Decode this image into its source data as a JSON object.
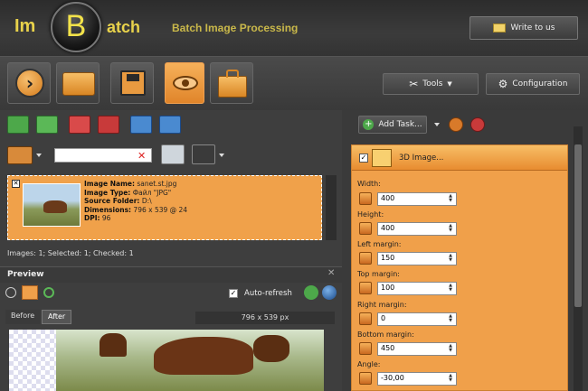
{
  "header": {
    "logo_left": "Im",
    "logo_mid": "B",
    "logo_right": "atch",
    "subtitle": "Batch Image Processing",
    "write_button": "Write to us"
  },
  "toolbar": {
    "tools_label": "Tools",
    "config_label": "Configuration"
  },
  "images": {
    "search_value": "",
    "details": [
      {
        "label": "Image Name:",
        "value": "sanet.st.jpg"
      },
      {
        "label": "Image Type:",
        "value": "Файл \"JPG\""
      },
      {
        "label": "Source Folder:",
        "value": "D:\\"
      },
      {
        "label": "Dimensions:",
        "value": "796 x 539 @ 24"
      },
      {
        "label": "DPI:",
        "value": "96"
      }
    ],
    "status": "Images: 1; Selected: 1; Checked: 1"
  },
  "preview": {
    "title": "Preview",
    "auto_refresh": "Auto-refresh",
    "tabs": [
      "Before",
      "After"
    ],
    "dimensions": "796 x 539 px"
  },
  "tasks": {
    "add_task": "Add Task...",
    "task_title": "3D Image...",
    "properties": [
      {
        "label": "Width:",
        "value": "400"
      },
      {
        "label": "Height:",
        "value": "400"
      },
      {
        "label": "Left margin:",
        "value": "150"
      },
      {
        "label": "Top margin:",
        "value": "100"
      },
      {
        "label": "Right margin:",
        "value": "0"
      },
      {
        "label": "Bottom margin:",
        "value": "450"
      },
      {
        "label": "Angle:",
        "value": "-30,00"
      }
    ]
  },
  "colors": {
    "accent_orange": "#f0a04a",
    "logo_yellow": "#e8d24b",
    "dark_bg": "#3a3a3a"
  }
}
